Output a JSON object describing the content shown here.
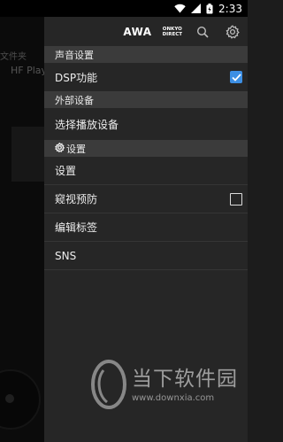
{
  "status_bar": {
    "time": "2:33"
  },
  "background_app": {
    "tab_label": "文件夹",
    "title": "HF Play"
  },
  "header": {
    "awa_label": "AWA",
    "onkyo_line1": "ONKYO",
    "onkyo_line2": "DIRECT"
  },
  "menu": {
    "section_sound": "声音设置",
    "dsp_label": "DSP功能",
    "dsp_checked": true,
    "section_external": "外部设备",
    "select_device_label": "选择播放设备",
    "section_settings": "设置",
    "settings_label": "设置",
    "peek_label": "窥视预防",
    "peek_checked": false,
    "edit_tags_label": "编辑标签",
    "sns_label": "SNS"
  },
  "watermark": {
    "text": "当下软件园",
    "url": "www.downxia.com"
  },
  "colors": {
    "accent": "#3d8fe4",
    "drawer_bg": "#262626",
    "section_bg": "#3b3b3b"
  }
}
